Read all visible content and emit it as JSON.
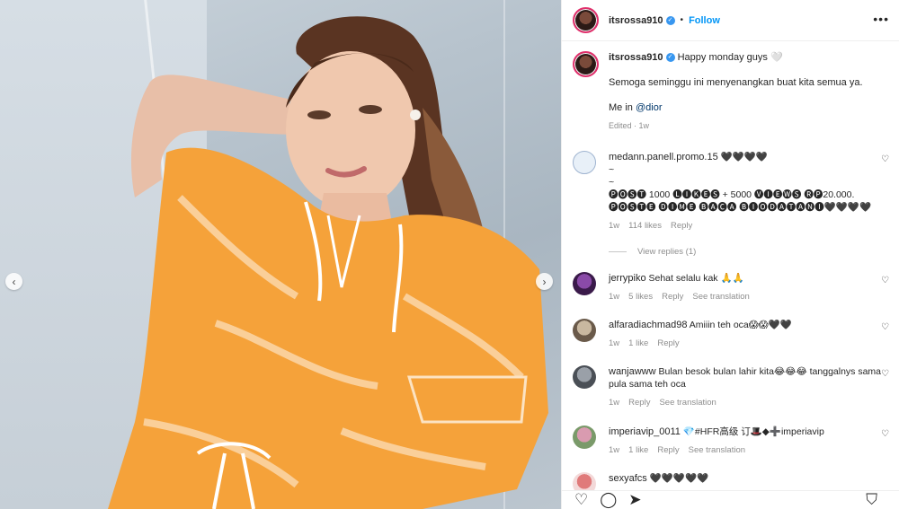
{
  "header": {
    "username": "itsrossa910",
    "follow_label": "Follow",
    "separator": "•",
    "more_label": "•••"
  },
  "caption": {
    "username": "itsrossa910",
    "line1": "Happy monday guys 🤍",
    "line2": "Semoga seminggu ini menyenangkan buat kita semua ya.",
    "line3_prefix": "Me in",
    "line3_mention": "@dior",
    "meta": "Edited · 1w"
  },
  "comments": [
    {
      "username": "medann.panell.promo.15",
      "text_lines": [
        "🖤🖤🖤🖤",
        "~",
        "~",
        "🅟🅞🅢🅣 1000 🅛🅘🅚🅔🅢 + 5000 🅥🅘🅔🅦🅢 🅡🅟20.000.",
        "🅟🅞🅢🅣🅔 🅓🅘🅜🅔 🅑🅐🅒🅐 🅑🅘🅞🅓🅐🅣🅐🅝🅘🖤🖤🖤🖤"
      ],
      "time": "1w",
      "likes": "114 likes",
      "reply": "Reply",
      "view_replies": "View replies (1)"
    },
    {
      "username": "jerrypiko",
      "text": "Sehat selalu kak 🙏🙏",
      "time": "1w",
      "likes": "5 likes",
      "reply": "Reply",
      "translation": "See translation"
    },
    {
      "username": "alfaradiachmad98",
      "text": "Amiiin teh oca😱😱🖤🖤",
      "time": "1w",
      "likes": "1 like",
      "reply": "Reply"
    },
    {
      "username": "wanjawww",
      "text": "Bulan besok bulan lahir kita😂😂😂 tanggalnys sama pula sama teh oca",
      "time": "1w",
      "reply": "Reply",
      "translation": "See translation"
    },
    {
      "username": "imperiavip_0011",
      "text": "💎#HFR高级 订🎩◆➕imperiavip",
      "time": "1w",
      "likes": "1 like",
      "reply": "Reply",
      "translation": "See translation"
    },
    {
      "username": "sexyafcs",
      "text": "🖤🖤🖤🖤🖤"
    }
  ],
  "icons": {
    "heart": "heart-icon",
    "comment": "comment-icon",
    "share": "share-icon",
    "bookmark": "bookmark-icon"
  },
  "colors": {
    "follow_blue": "#0095f6",
    "verified_blue": "#3897f0",
    "dress_orange": "#f5a23a"
  }
}
